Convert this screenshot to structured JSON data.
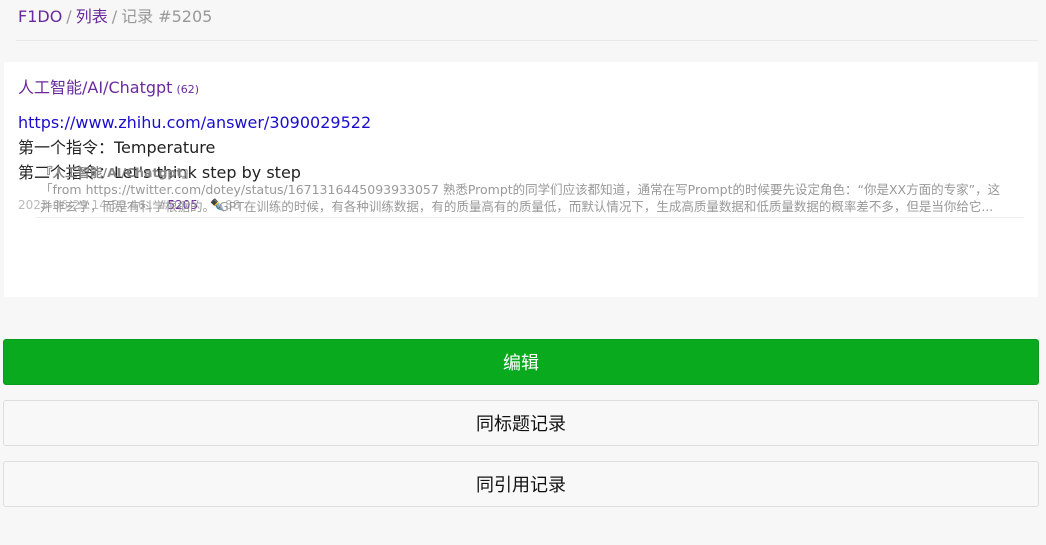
{
  "breadcrumb": {
    "home": "F1DO",
    "list": "列表",
    "current": "记录 #5205",
    "separator": "/"
  },
  "record": {
    "tag": "人工智能/AI/Chatgpt",
    "tag_count": "(62)",
    "url": "https://www.zhihu.com/answer/3090029522",
    "lines": [
      "第一个指令：Temperature",
      "第二个指令：Let's think step by step"
    ],
    "timestamp": "2023-06-29 14:50:46",
    "id_prefix": "#",
    "id": "5205",
    "edit_icon": "✒️",
    "edit_count": "88"
  },
  "quote": {
    "title": "『人工智能/AI/Chatgpt』",
    "body": "「from https://twitter.com/dotey/status/1671316445093933057 熟悉Prompt的同学们应该都知道，通常在写Prompt的时候要先设定角色：“你是XX方面的专家”，这并非玄学，而是有科学根据的。 GPT在训练的时候，有各种训练数据，有的质量高有的质量低，而默认情况下，生成高质量数据和低质量数据的概率差不多，但是当你给它..."
  },
  "buttons": {
    "edit": "编辑",
    "same_title": "同标题记录",
    "same_reference": "同引用记录"
  },
  "colors": {
    "primary": "#0aaa1f",
    "link_purple": "#6a2a9c",
    "link_blue": "#1a0dcc"
  }
}
